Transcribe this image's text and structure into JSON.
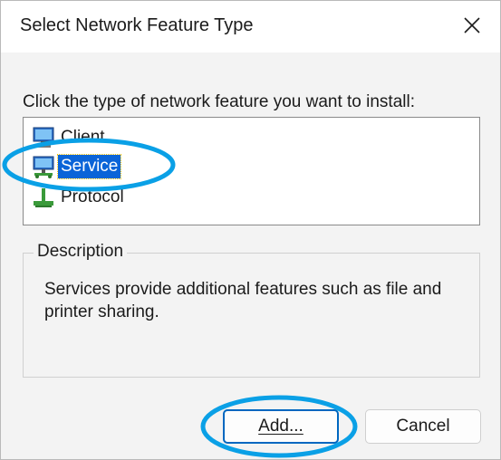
{
  "window": {
    "title": "Select Network Feature Type",
    "close_icon": "close-icon"
  },
  "prompt": "Click the type of network feature you want to install:",
  "feature_list": {
    "items": [
      {
        "label": "Client",
        "icon": "client-computer-icon",
        "selected": false
      },
      {
        "label": "Service",
        "icon": "service-icon",
        "selected": true
      },
      {
        "label": "Protocol",
        "icon": "protocol-icon",
        "selected": false
      }
    ]
  },
  "description": {
    "legend": "Description",
    "text": "Services provide additional features such as file and printer sharing."
  },
  "buttons": {
    "add_label": "Add...",
    "cancel_label": "Cancel"
  },
  "colors": {
    "selection": "#0a64d8",
    "annotation": "#0aa0e6",
    "default_button_border": "#0067c0"
  }
}
